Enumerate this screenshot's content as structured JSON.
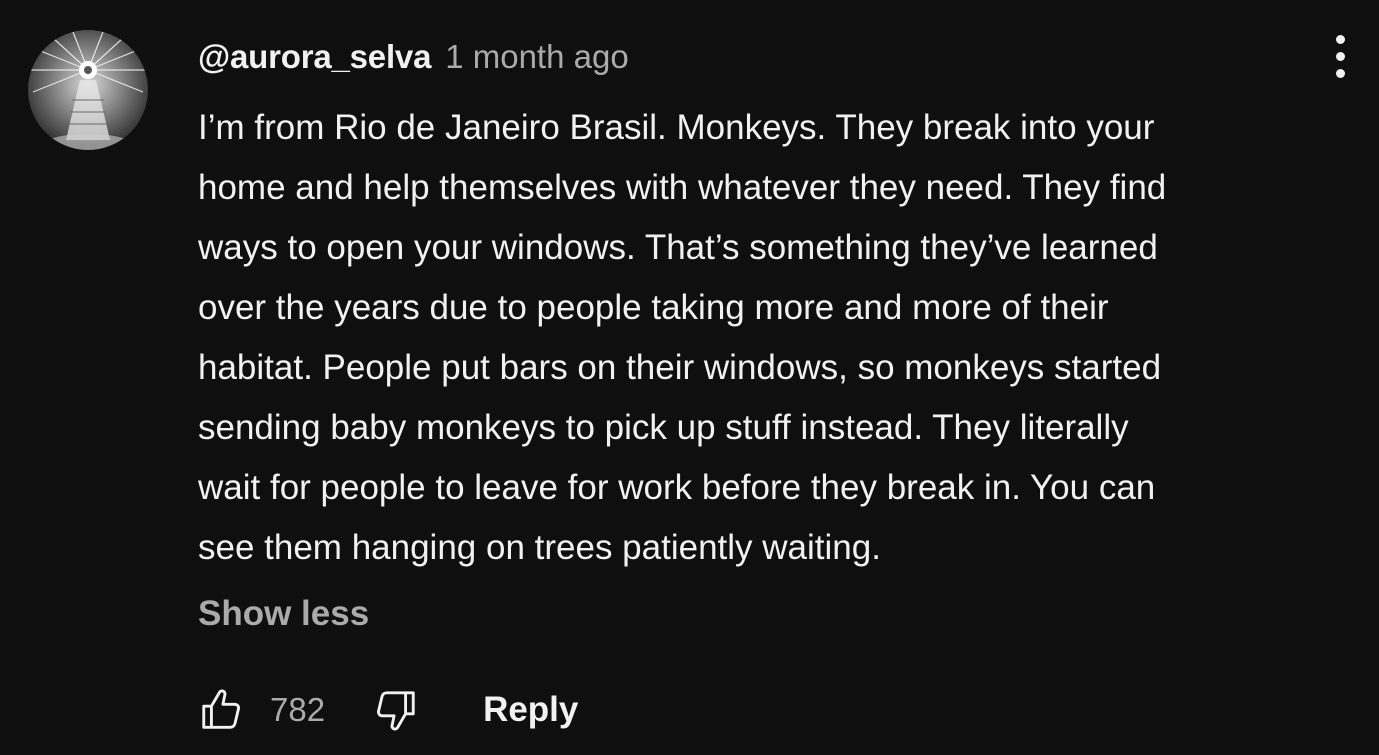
{
  "comment": {
    "author": "@aurora_selva",
    "time": "1 month ago",
    "body_lines": [
      "I’m from Rio de Janeiro Brasil. Monkeys. They break into your",
      "home and help themselves with whatever they need. They find",
      "ways to open your windows. That’s something they’ve learned",
      "over the years due to people taking more and more of their",
      "habitat. People put bars on their windows, so monkeys started",
      "sending baby monkeys to pick up stuff instead. They literally",
      "wait for people to leave for work before they break in. You can",
      "see them hanging on trees patiently waiting."
    ],
    "show_less_label": "Show less",
    "like_count": "782",
    "reply_label": "Reply"
  },
  "icons": {
    "menu": "more-vertical-icon",
    "like": "thumbs-up-icon",
    "dislike": "thumbs-down-icon"
  },
  "colors": {
    "background": "#0f0f0f",
    "primary_text": "#f1f1f1",
    "secondary_text": "#aaaaaa"
  }
}
